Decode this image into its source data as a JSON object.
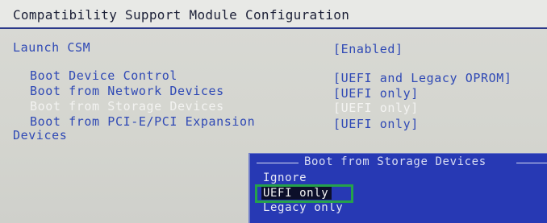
{
  "header": {
    "title": "Compatibility Support Module Configuration"
  },
  "settings": [
    {
      "label": "Launch CSM",
      "value": "[Enabled]"
    },
    {
      "label": "Boot Device Control",
      "value": "[UEFI and Legacy OPROM]"
    },
    {
      "label": "Boot from Network Devices",
      "value": "[UEFI only]"
    },
    {
      "label": "Boot from Storage Devices",
      "value": "[UEFI only]",
      "selected": true
    },
    {
      "label": "Boot from PCI-E/PCI Expansion",
      "label_cont": "Devices",
      "value": "[UEFI only]"
    }
  ],
  "popup": {
    "title": "Boot from Storage Devices",
    "options": [
      "Ignore",
      "UEFI only",
      "Legacy only"
    ],
    "selected_option": "UEFI only"
  },
  "colors": {
    "background": "#d7d8d3",
    "text_blue": "#2f49b5",
    "selected_text": "#f3f3f1",
    "popup_bg": "#2739b4",
    "highlight_bg": "#0c0f2a",
    "annotation_green": "#25a24a"
  }
}
